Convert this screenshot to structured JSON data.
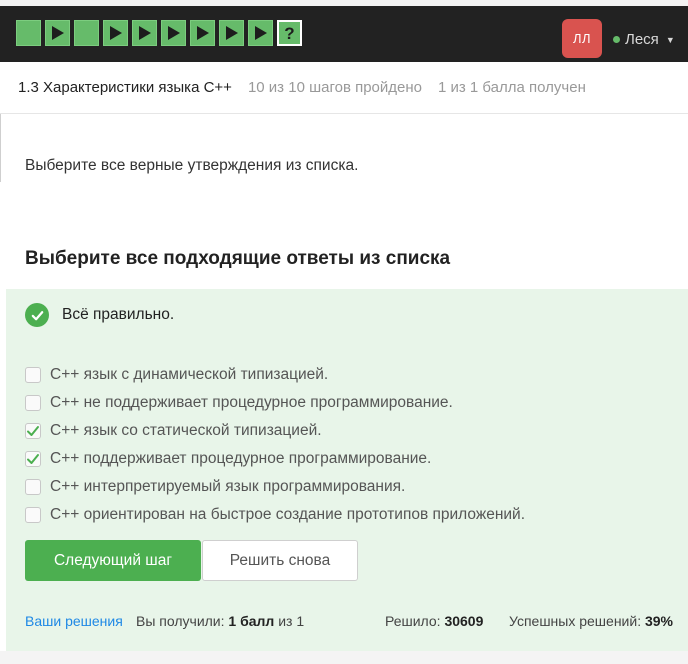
{
  "topbar": {
    "steps": [
      "done",
      "done-play",
      "done",
      "done-play",
      "done-play",
      "done-play",
      "done-play",
      "done-play",
      "done-play",
      "current-question"
    ],
    "current_step_glyph": "?",
    "avatar_initials": "ЛЛ",
    "user_name": "Леся"
  },
  "lesson": {
    "title": "1.3 Характеристики языка C++",
    "progress": "10 из 10 шагов пройдено",
    "score": "1 из 1 балла  получен"
  },
  "task": {
    "prompt": "Выберите все верные утверждения из списка.",
    "heading": "Выберите все подходящие ответы из списка"
  },
  "result": {
    "message": "Всё правильно.",
    "options": [
      {
        "label": "C++ язык с динамической типизацией.",
        "checked": false
      },
      {
        "label": "C++ не поддерживает процедурное программирование.",
        "checked": false
      },
      {
        "label": "C++ язык со статической типизацией.",
        "checked": true
      },
      {
        "label": "C++ поддерживает процедурное программирование.",
        "checked": true
      },
      {
        "label": "C++ интерпретируемый язык программирования.",
        "checked": false
      },
      {
        "label": "C++ ориентирован на быстрое создание прототипов приложений.",
        "checked": false
      }
    ],
    "next_button": "Следующий шаг",
    "retry_button": "Решить снова"
  },
  "footer": {
    "solutions_link": "Ваши решения",
    "got_prefix": "Вы получили: ",
    "got_value": "1 балл",
    "got_suffix": " из 1",
    "solved_prefix": "Решило: ",
    "solved_value": "30609",
    "success_prefix": "Успешных решений: ",
    "success_value": "39%"
  },
  "colors": {
    "accent_green": "#4caf50",
    "panel_green": "#e8f5e9",
    "avatar_red": "#d9534f",
    "link_blue": "#1e88e5"
  }
}
